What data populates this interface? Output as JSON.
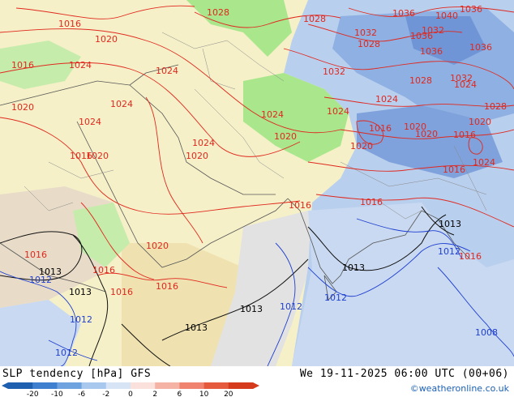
{
  "footer": {
    "title": "SLP tendency [hPa] GFS",
    "valid_time": "We 19-11-2025 06:00 UTC (00+06)",
    "credit": "©weatheronline.co.uk"
  },
  "colorbar": {
    "tick_labels": [
      "-20",
      "-10",
      "-6",
      "-2",
      "0",
      "2",
      "6",
      "10",
      "20"
    ],
    "colors": [
      "#1f5fb0",
      "#3f7fd0",
      "#6fa3e0",
      "#a9c8ee",
      "#d6e4f5",
      "#fbe1dc",
      "#f5b3a6",
      "#ef8370",
      "#e55a3c",
      "#d63a1c"
    ]
  },
  "map": {
    "isobar_labels_red": [
      {
        "text": "1016"
      },
      {
        "text": "1020"
      },
      {
        "text": "1016"
      },
      {
        "text": "1024"
      },
      {
        "text": "1020"
      },
      {
        "text": "1024"
      },
      {
        "text": "1024"
      },
      {
        "text": "1024"
      },
      {
        "text": "1024"
      },
      {
        "text": "1020"
      },
      {
        "text": "1020"
      },
      {
        "text": "1024"
      },
      {
        "text": "1028"
      },
      {
        "text": "1028"
      },
      {
        "text": "1032"
      },
      {
        "text": "1028"
      },
      {
        "text": "1036"
      },
      {
        "text": "1040"
      },
      {
        "text": "1036"
      },
      {
        "text": "1036"
      },
      {
        "text": "1032"
      },
      {
        "text": "1036"
      },
      {
        "text": "1036"
      },
      {
        "text": "1032"
      },
      {
        "text": "1028"
      },
      {
        "text": "1032"
      },
      {
        "text": "1024"
      },
      {
        "text": "1024"
      },
      {
        "text": "1024"
      },
      {
        "text": "1028"
      },
      {
        "text": "1016"
      },
      {
        "text": "1020"
      },
      {
        "text": "1020"
      },
      {
        "text": "1016"
      },
      {
        "text": "1020"
      },
      {
        "text": "1020"
      },
      {
        "text": "1024"
      },
      {
        "text": "1016"
      },
      {
        "text": "1020"
      },
      {
        "text": "1016"
      },
      {
        "text": "1016"
      },
      {
        "text": "1020"
      },
      {
        "text": "1016"
      },
      {
        "text": "1016"
      },
      {
        "text": "1016"
      },
      {
        "text": "1016"
      },
      {
        "text": "1016"
      },
      {
        "text": "1016"
      }
    ],
    "isobar_labels_black": [
      {
        "text": "1013"
      },
      {
        "text": "1013"
      },
      {
        "text": "1013"
      },
      {
        "text": "1013"
      },
      {
        "text": "1013"
      },
      {
        "text": "1013"
      }
    ],
    "isobar_labels_blue": [
      {
        "text": "1012"
      },
      {
        "text": "1012"
      },
      {
        "text": "1012"
      },
      {
        "text": "1012"
      },
      {
        "text": "1012"
      },
      {
        "text": "1008"
      },
      {
        "text": "1012"
      }
    ]
  }
}
